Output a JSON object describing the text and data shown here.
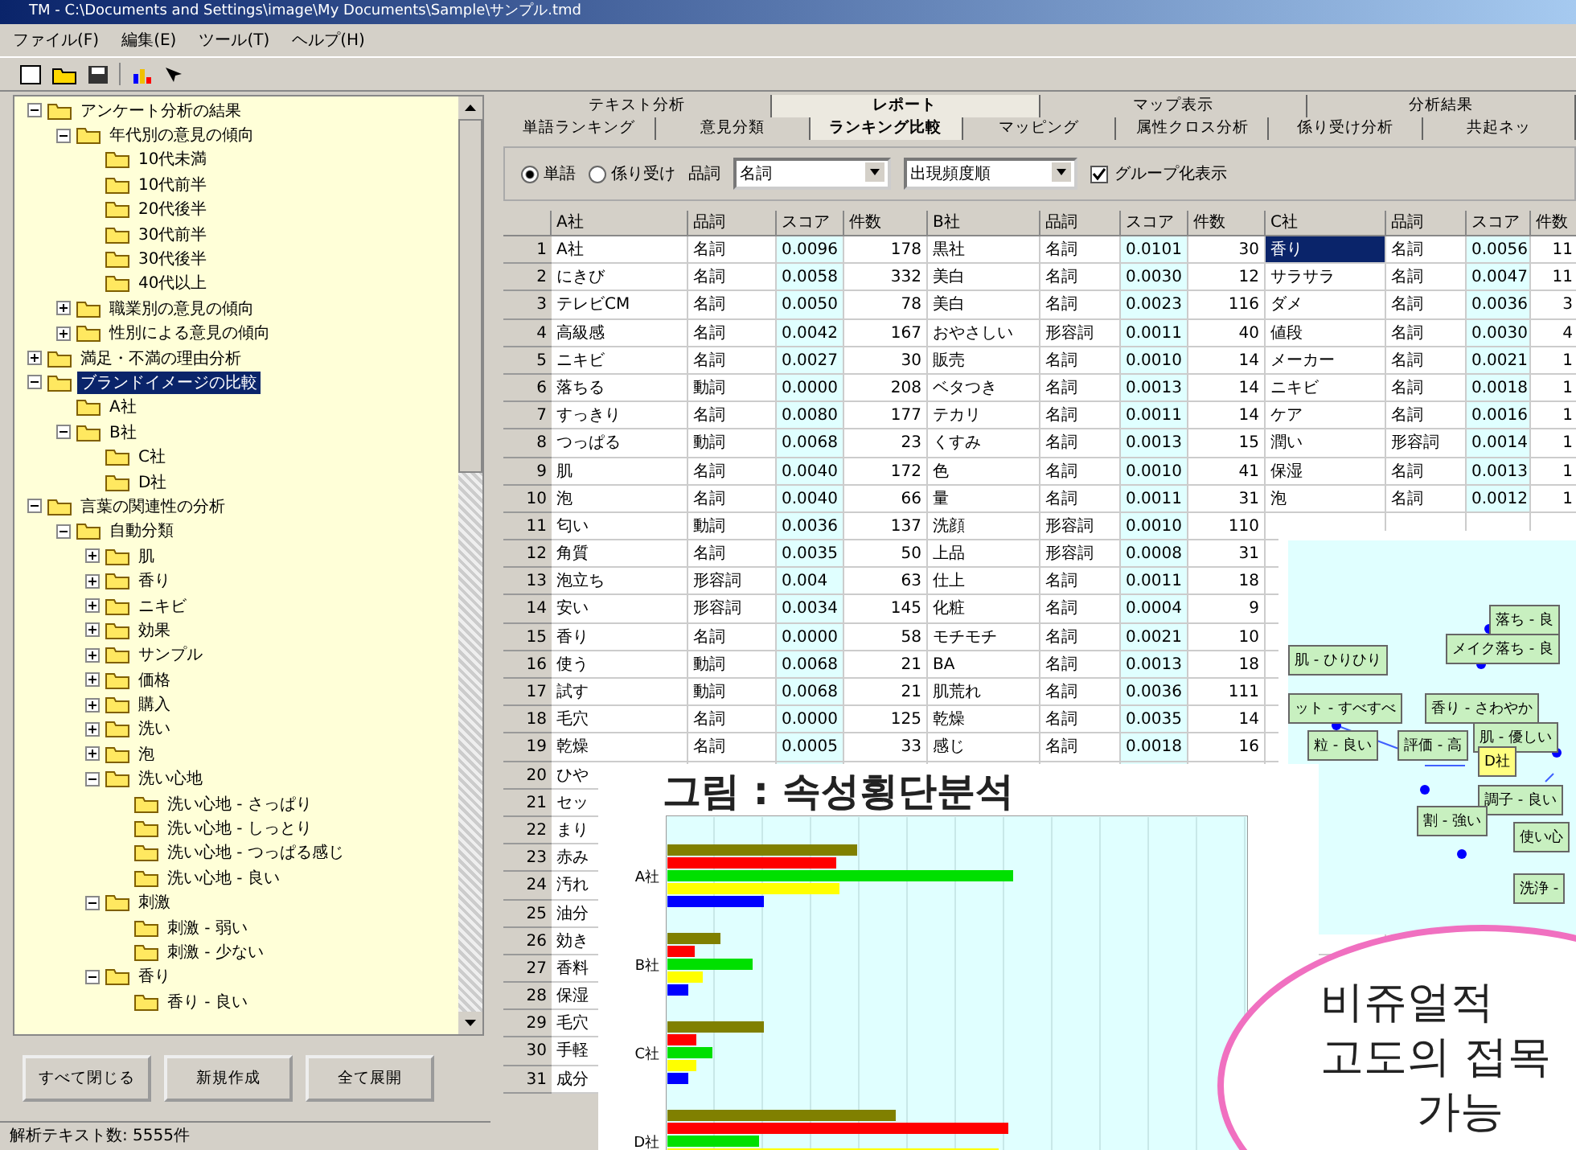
{
  "window": {
    "title": "TM - C:\\Documents and Settings\\image\\My Documents\\Sample\\サンプル.tmd"
  },
  "menu": [
    "ファイル(F)",
    "編集(E)",
    "ツール(T)",
    "ヘルプ(H)"
  ],
  "tree": [
    {
      "label": "アンケート分析の結果",
      "expanded": true,
      "selected": false,
      "children": [
        {
          "label": "年代別の意見の傾向",
          "expanded": true,
          "selected": false,
          "children": [
            {
              "label": "10代未満",
              "selected": false
            },
            {
              "label": "10代前半",
              "selected": false
            },
            {
              "label": "20代後半",
              "selected": false
            },
            {
              "label": "30代前半",
              "selected": false
            },
            {
              "label": "30代後半",
              "selected": false
            },
            {
              "label": "40代以上",
              "selected": false
            }
          ]
        },
        {
          "label": "職業別の意見の傾向",
          "expanded": false,
          "selected": false
        },
        {
          "label": "性別による意見の傾向",
          "expanded": false,
          "selected": false
        }
      ]
    },
    {
      "label": "満足・不満の理由分析",
      "expanded": false,
      "selected": false
    },
    {
      "label": "ブランドイメージの比較",
      "expanded": true,
      "selected": true,
      "children": [
        {
          "label": "A社",
          "selected": false
        },
        {
          "label": "B社",
          "expanded": true,
          "selected": false,
          "children": [
            {
              "label": "C社",
              "selected": false
            },
            {
              "label": "D社",
              "selected": false
            }
          ]
        }
      ]
    },
    {
      "label": "言葉の関連性の分析",
      "expanded": true,
      "selected": false,
      "children": [
        {
          "label": "自動分類",
          "expanded": true,
          "selected": false,
          "children": [
            {
              "label": "肌",
              "expanded": false,
              "selected": false
            },
            {
              "label": "香り",
              "expanded": false,
              "selected": false
            },
            {
              "label": "ニキビ",
              "expanded": false,
              "selected": false
            },
            {
              "label": "効果",
              "expanded": false,
              "selected": false
            },
            {
              "label": "サンプル",
              "expanded": false,
              "selected": false
            },
            {
              "label": "価格",
              "expanded": false,
              "selected": false
            },
            {
              "label": "購入",
              "expanded": false,
              "selected": false
            },
            {
              "label": "洗い",
              "expanded": false,
              "selected": false
            },
            {
              "label": "泡",
              "expanded": false,
              "selected": false
            },
            {
              "label": "洗い心地",
              "expanded": true,
              "selected": false,
              "children": [
                {
                  "label": "洗い心地 - さっぱり",
                  "selected": false
                },
                {
                  "label": "洗い心地 - しっとり",
                  "selected": false
                },
                {
                  "label": "洗い心地 - つっぱる感じ",
                  "selected": false
                },
                {
                  "label": "洗い心地 - 良い",
                  "selected": false
                }
              ]
            },
            {
              "label": "刺激",
              "expanded": true,
              "selected": false,
              "children": [
                {
                  "label": "刺激 - 弱い",
                  "selected": false
                },
                {
                  "label": "刺激 - 少ない",
                  "selected": false
                }
              ]
            },
            {
              "label": "香り",
              "expanded": true,
              "selected": false,
              "children": [
                {
                  "label": "香り - 良い",
                  "selected": false
                }
              ]
            }
          ]
        }
      ]
    }
  ],
  "buttons": [
    "すべて閉じる",
    "新規作成",
    "全て展開"
  ],
  "status_bar": "解析テキスト数: 5555件",
  "tabs_top": [
    {
      "label": "テキスト分析",
      "selected": false
    },
    {
      "label": "レポート",
      "selected": true
    },
    {
      "label": "マップ表示",
      "selected": false
    },
    {
      "label": "分析結果",
      "selected": false
    }
  ],
  "tabs": [
    {
      "label": "単語ランキング",
      "selected": false
    },
    {
      "label": "意見分類",
      "selected": false
    },
    {
      "label": "ランキング比較",
      "selected": true
    },
    {
      "label": "マッピング",
      "selected": false
    },
    {
      "label": "属性クロス分析",
      "selected": false
    },
    {
      "label": "係り受け分析",
      "selected": false
    },
    {
      "label": "共起ネッ",
      "selected": false
    }
  ],
  "options": {
    "radios": [
      {
        "label": "単語",
        "selected": true
      },
      {
        "label": "係り受け",
        "selected": false
      }
    ],
    "pos_label": "品詞",
    "pos_value": "名詞",
    "order_value": "出現頻度順",
    "group_checkbox": {
      "label": "グループ化表示",
      "checked": true
    }
  },
  "table": {
    "columns": [
      "A社",
      "品詞",
      "スコア",
      "件数",
      "B社",
      "品詞",
      "スコア",
      "件数",
      "C社",
      "品詞",
      "スコア",
      "件数"
    ],
    "rows": [
      {
        "no": "1",
        "a": [
          "A社",
          "名詞",
          "0.0096",
          "178"
        ],
        "b": [
          "黒社",
          "名詞",
          "0.0101",
          "30"
        ],
        "c": [
          "香り",
          "名詞",
          "0.0056",
          "11"
        ],
        "c_selected": true
      },
      {
        "no": "2",
        "a": [
          "にきび",
          "名詞",
          "0.0058",
          "332"
        ],
        "b": [
          "美白",
          "名詞",
          "0.0030",
          "12"
        ],
        "c": [
          "サラサラ",
          "名詞",
          "0.0047",
          "11"
        ],
        "c_selected": false
      },
      {
        "no": "3",
        "a": [
          "テレビCM",
          "名詞",
          "0.0050",
          "78"
        ],
        "b": [
          "美白",
          "名詞",
          "0.0023",
          "116"
        ],
        "c": [
          "ダメ",
          "名詞",
          "0.0036",
          "3"
        ],
        "c_selected": false
      },
      {
        "no": "4",
        "a": [
          "高級感",
          "名詞",
          "0.0042",
          "167"
        ],
        "b": [
          "おやさしい",
          "形容詞",
          "0.0011",
          "40"
        ],
        "c": [
          "値段",
          "名詞",
          "0.0030",
          "4"
        ],
        "c_selected": false
      },
      {
        "no": "5",
        "a": [
          "ニキビ",
          "名詞",
          "0.0027",
          "30"
        ],
        "b": [
          "販売",
          "名詞",
          "0.0010",
          "14"
        ],
        "c": [
          "メーカー",
          "名詞",
          "0.0021",
          "1"
        ],
        "c_selected": false
      },
      {
        "no": "6",
        "a": [
          "落ちる",
          "動詞",
          "0.0000",
          "208"
        ],
        "b": [
          "ベタつき",
          "名詞",
          "0.0013",
          "14"
        ],
        "c": [
          "ニキビ",
          "名詞",
          "0.0018",
          "1"
        ],
        "c_selected": false
      },
      {
        "no": "7",
        "a": [
          "すっきり",
          "名詞",
          "0.0080",
          "177"
        ],
        "b": [
          "テカリ",
          "名詞",
          "0.0011",
          "14"
        ],
        "c": [
          "ケア",
          "名詞",
          "0.0016",
          "1"
        ],
        "c_selected": false
      },
      {
        "no": "8",
        "a": [
          "つっぱる",
          "動詞",
          "0.0068",
          "23"
        ],
        "b": [
          "くすみ",
          "名詞",
          "0.0013",
          "15"
        ],
        "c": [
          "潤い",
          "形容詞",
          "0.0014",
          "1"
        ],
        "c_selected": false
      },
      {
        "no": "9",
        "a": [
          "肌",
          "名詞",
          "0.0040",
          "172"
        ],
        "b": [
          "色",
          "名詞",
          "0.0010",
          "41"
        ],
        "c": [
          "保湿",
          "名詞",
          "0.0013",
          "1"
        ],
        "c_selected": false
      },
      {
        "no": "10",
        "a": [
          "泡",
          "名詞",
          "0.0040",
          "66"
        ],
        "b": [
          "量",
          "名詞",
          "0.0011",
          "31"
        ],
        "c": [
          "泡",
          "名詞",
          "0.0012",
          "1"
        ],
        "c_selected": false
      },
      {
        "no": "11",
        "a": [
          "匂い",
          "動詞",
          "0.0036",
          "137"
        ],
        "b": [
          "洗顔",
          "形容詞",
          "0.0010",
          "110"
        ],
        "c": []
      },
      {
        "no": "12",
        "a": [
          "角質",
          "名詞",
          "0.0035",
          "50"
        ],
        "b": [
          "上品",
          "形容詞",
          "0.0008",
          "31"
        ],
        "c": []
      },
      {
        "no": "13",
        "a": [
          "泡立ち",
          "形容詞",
          "0.004",
          "63"
        ],
        "b": [
          "仕上",
          "名詞",
          "0.0011",
          "18"
        ],
        "c": []
      },
      {
        "no": "14",
        "a": [
          "安い",
          "形容詞",
          "0.0034",
          "145"
        ],
        "b": [
          "化粧",
          "名詞",
          "0.0004",
          "9"
        ],
        "c": []
      },
      {
        "no": "15",
        "a": [
          "香り",
          "名詞",
          "0.0000",
          "58"
        ],
        "b": [
          "モチモチ",
          "名詞",
          "0.0021",
          "10"
        ],
        "c": []
      },
      {
        "no": "16",
        "a": [
          "使う",
          "動詞",
          "0.0068",
          "21"
        ],
        "b": [
          "BA",
          "名詞",
          "0.0013",
          "18"
        ],
        "c": []
      },
      {
        "no": "17",
        "a": [
          "試す",
          "動詞",
          "0.0068",
          "21"
        ],
        "b": [
          "肌荒れ",
          "名詞",
          "0.0036",
          "111"
        ],
        "c": []
      },
      {
        "no": "18",
        "a": [
          "毛穴",
          "名詞",
          "0.0000",
          "125"
        ],
        "b": [
          "乾燥",
          "名詞",
          "0.0035",
          "14"
        ],
        "c": []
      },
      {
        "no": "19",
        "a": [
          "乾燥",
          "名詞",
          "0.0005",
          "33"
        ],
        "b": [
          "感じ",
          "名詞",
          "0.0018",
          "16"
        ],
        "c": []
      },
      {
        "no": "20",
        "a": [
          "ひや"
        ],
        "b": [],
        "c": []
      },
      {
        "no": "21",
        "a": [
          "セッ"
        ],
        "b": [],
        "c": []
      },
      {
        "no": "22",
        "a": [
          "まり"
        ],
        "b": [],
        "c": []
      },
      {
        "no": "23",
        "a": [
          "赤み"
        ],
        "b": [],
        "c": []
      },
      {
        "no": "24",
        "a": [
          "汚れ"
        ],
        "b": [],
        "c": []
      },
      {
        "no": "25",
        "a": [
          "油分"
        ],
        "b": [],
        "c": []
      },
      {
        "no": "26",
        "a": [
          "効き"
        ],
        "b": [],
        "c": []
      },
      {
        "no": "27",
        "a": [
          "香料"
        ],
        "b": [],
        "c": []
      },
      {
        "no": "28",
        "a": [
          "保湿"
        ],
        "b": [],
        "c": []
      },
      {
        "no": "29",
        "a": [
          "毛穴"
        ],
        "b": [],
        "c": []
      },
      {
        "no": "30",
        "a": [
          "手軽"
        ],
        "b": [],
        "c": []
      },
      {
        "no": "31",
        "a": [
          "成分"
        ],
        "b": [],
        "c": []
      }
    ]
  },
  "network": {
    "nodes": [
      {
        "label": "落ち - 良",
        "kind": "word"
      },
      {
        "label": "メイク落ち - 良",
        "kind": "word"
      },
      {
        "label": "肌 - ひりひり",
        "kind": "word"
      },
      {
        "label": "ット - すべすべ",
        "kind": "word"
      },
      {
        "label": "香り - さわやか",
        "kind": "word"
      },
      {
        "label": "肌 - 優しい",
        "kind": "word"
      },
      {
        "label": "粒 - 良い",
        "kind": "word"
      },
      {
        "label": "評価 - 高",
        "kind": "word"
      },
      {
        "label": "D社",
        "kind": "company"
      },
      {
        "label": "調子 - 良い",
        "kind": "word"
      },
      {
        "label": "割 - 強い",
        "kind": "word"
      },
      {
        "label": "使い心",
        "kind": "word"
      },
      {
        "label": "洗浄 -",
        "kind": "word"
      }
    ]
  },
  "figure": {
    "title": "그림 : 속성횡단분석",
    "categories": [
      "A社",
      "B社",
      "C社",
      "D社"
    ]
  },
  "callout": {
    "lines": [
      "비쥬얼적",
      "고도의 접목",
      "가능"
    ]
  }
}
